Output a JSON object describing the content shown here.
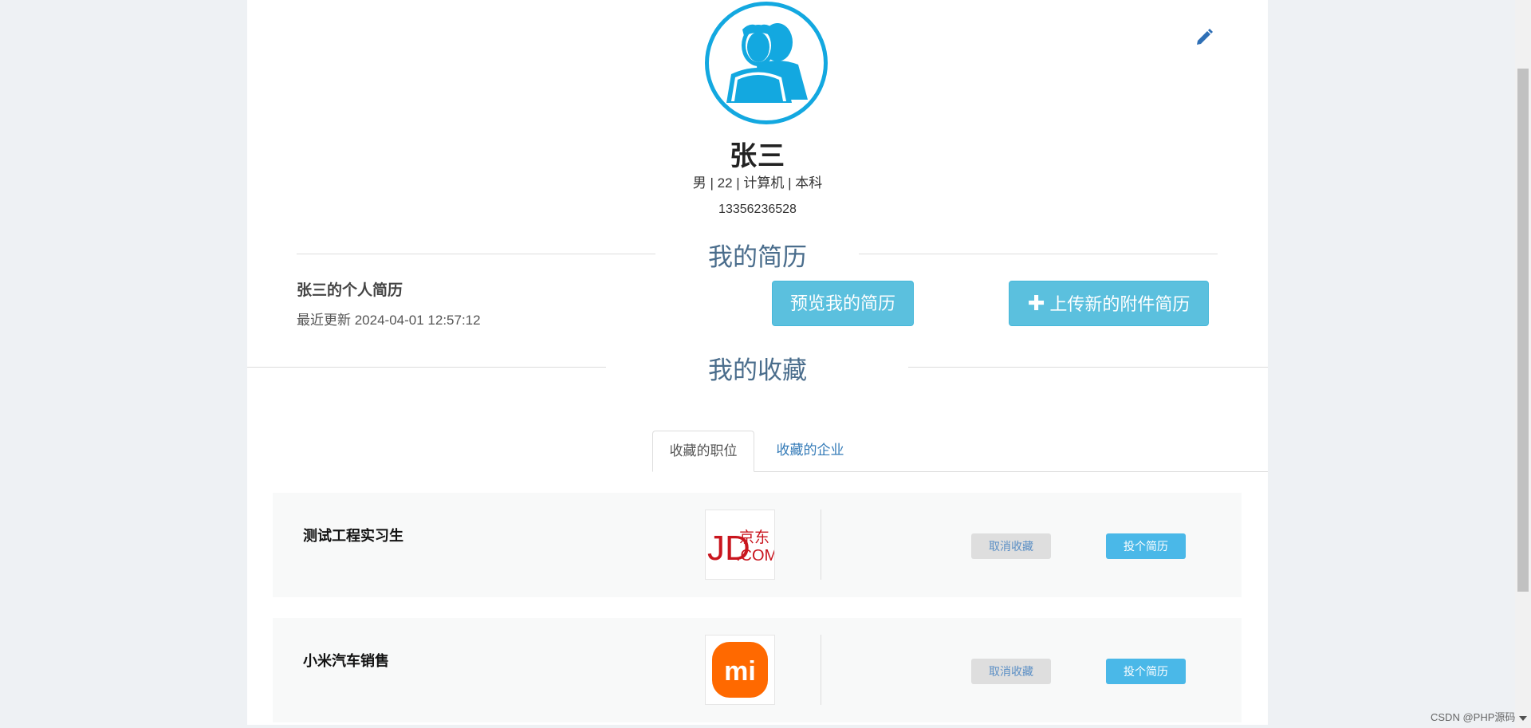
{
  "profile": {
    "name": "张三",
    "meta": "男 | 22 | 计算机 | 本科",
    "phone": "13356236528",
    "avatar_icon": "user-group-icon",
    "edit_icon": "pencil-icon"
  },
  "resume_section": {
    "title": "我的简历",
    "resume_name": "张三的个人简历",
    "updated": "最近更新 2024-04-01 12:57:12",
    "preview_button": "预览我的简历",
    "upload_button": "上传新的附件简历"
  },
  "favorites_section": {
    "title": "我的收藏",
    "tabs": [
      {
        "label": "收藏的职位",
        "active": true
      },
      {
        "label": "收藏的企业",
        "active": false
      }
    ],
    "jobs": [
      {
        "title": "测试工程实习生",
        "company_logo": "jd-logo",
        "logo_text_1": "JD",
        "logo_text_2": "京东",
        "logo_text_3": ".COM",
        "cancel_label": "取消收藏",
        "apply_label": "投个简历"
      },
      {
        "title": "小米汽车销售",
        "company_logo": "xiaomi-logo",
        "logo_text_1": "mi",
        "cancel_label": "取消收藏",
        "apply_label": "投个简历"
      }
    ]
  },
  "watermark": "CSDN @PHP源码",
  "colors": {
    "accent": "#5bc0de",
    "heading": "#4a6d8c",
    "avatar": "#13a8e0",
    "link": "#337ab7",
    "jd_red": "#c9151e",
    "xiaomi_orange": "#ff6900"
  }
}
